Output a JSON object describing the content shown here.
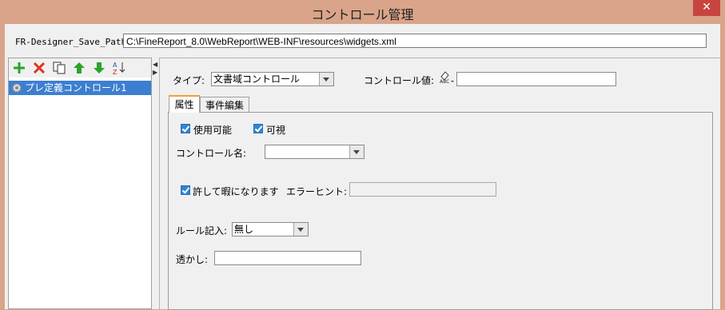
{
  "window": {
    "title": "コントロール管理",
    "close_glyph": "✕"
  },
  "path": {
    "label": "FR-Designer_Save_Path:",
    "value": "C:\\FineReport_8.0\\WebReport\\WEB-INF\\resources\\widgets.xml"
  },
  "toolbar": {
    "icons": [
      "add-icon",
      "delete-icon",
      "copy-icon",
      "move-up-icon",
      "move-down-icon",
      "sort-icon"
    ]
  },
  "tree": {
    "items": [
      {
        "label": "プレ定義コントロール1"
      }
    ]
  },
  "form": {
    "type_label": "タイプ:",
    "type_value": "文書域コントロール",
    "control_value_label": "コントロール値:",
    "control_value": "",
    "tabs": [
      {
        "label": "属性"
      },
      {
        "label": "事件編集"
      }
    ],
    "enabled_label": "使用可能",
    "visible_label": "可視",
    "control_name_label": "コントロール名:",
    "control_name_value": "",
    "allow_blank_label": "許して暇になります",
    "error_hint_label": "エラーヒント:",
    "error_hint_value": "",
    "rule_label": "ルール記入:",
    "rule_value": "無し",
    "watermark_label": "透かし:",
    "watermark_value": ""
  },
  "colors": {
    "accent": "#3c7fd0",
    "titlebar": "#d9a48a",
    "close": "#c7453f"
  }
}
